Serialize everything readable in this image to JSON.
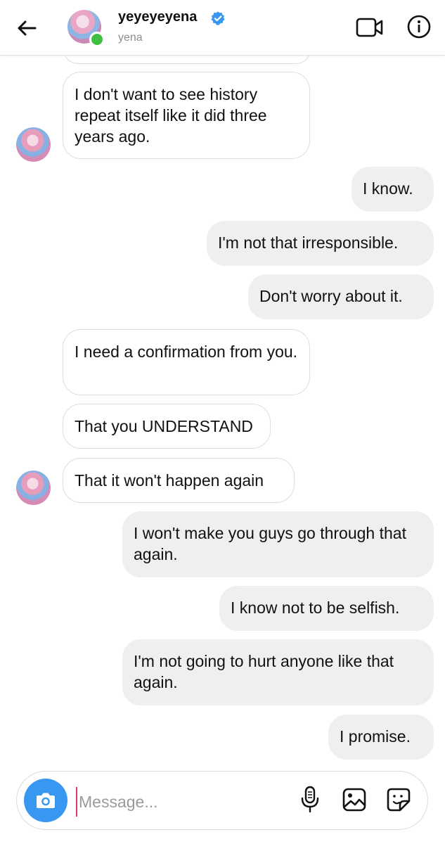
{
  "header": {
    "username": "yeyeyeyena",
    "handle": "yena",
    "verified": true,
    "online": true
  },
  "messages": [
    {
      "side": "in",
      "text": "I don't want to see history repeat itself like it did three years ago.",
      "avatar": true
    },
    {
      "side": "out",
      "text": "I know."
    },
    {
      "side": "out",
      "text": "I'm not that irresponsible."
    },
    {
      "side": "out",
      "text": "Don't worry about it."
    },
    {
      "side": "in",
      "text": "I need a confirmation from you."
    },
    {
      "side": "in",
      "text": "That you UNDERSTAND"
    },
    {
      "side": "in",
      "text": "That it won't happen again",
      "avatar": true
    },
    {
      "side": "out",
      "text": "I won't make you guys go through that again."
    },
    {
      "side": "out",
      "text": "I know not to be selfish."
    },
    {
      "side": "out",
      "text": "I'm not going to hurt anyone like that again."
    },
    {
      "side": "out",
      "text": "I promise."
    }
  ],
  "composer": {
    "placeholder": "Message..."
  },
  "colors": {
    "accent": "#3897f0",
    "online": "#3fc042",
    "outgoing_bubble": "#efefef",
    "incoming_border": "#dedede"
  },
  "icons": [
    "back-arrow-icon",
    "verified-badge-icon",
    "video-call-icon",
    "info-icon",
    "camera-icon",
    "microphone-icon",
    "gallery-icon",
    "sticker-icon"
  ]
}
